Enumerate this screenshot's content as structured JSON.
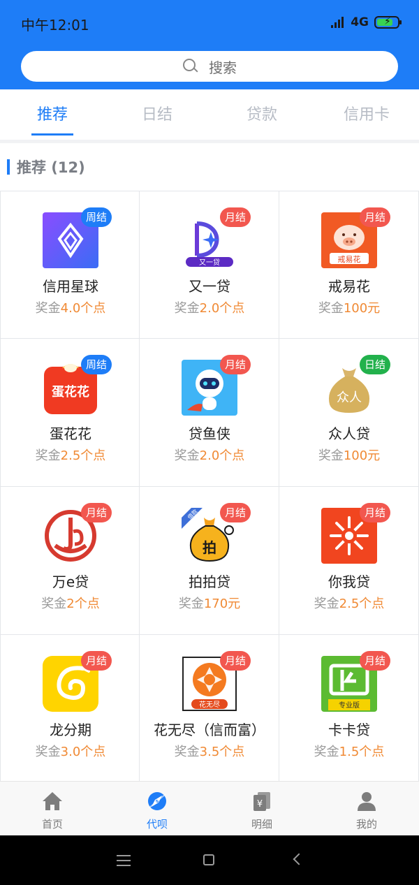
{
  "status": {
    "time": "中午12:01",
    "network": "4G"
  },
  "search": {
    "placeholder": "搜索"
  },
  "tabs": [
    {
      "label": "推荐",
      "active": true
    },
    {
      "label": "日结",
      "active": false
    },
    {
      "label": "贷款",
      "active": false
    },
    {
      "label": "信用卡",
      "active": false
    }
  ],
  "section": {
    "title": "推荐 (12)"
  },
  "reward_label": "奖金",
  "products": [
    {
      "name": "信用星球",
      "badge": "周结",
      "badge_type": "weekly",
      "reward": "4.0个点",
      "icon": "diamond-icon"
    },
    {
      "name": "又一贷",
      "badge": "月结",
      "badge_type": "monthly",
      "reward": "2.0个点",
      "icon": "youyidai-logo-icon",
      "logo_text": "又一贷"
    },
    {
      "name": "戒易花",
      "badge": "月结",
      "badge_type": "monthly",
      "reward": "100元",
      "icon": "pig-icon",
      "logo_text": "戒易花"
    },
    {
      "name": "蛋花花",
      "badge": "周结",
      "badge_type": "weekly",
      "reward": "2.5个点",
      "icon": "danhuahua-logo-icon",
      "logo_text": "蛋花花"
    },
    {
      "name": "贷鱼侠",
      "badge": "月结",
      "badge_type": "monthly",
      "reward": "2.0个点",
      "icon": "robot-icon"
    },
    {
      "name": "众人贷",
      "badge": "日结",
      "badge_type": "daily",
      "reward": "100元",
      "icon": "money-bag-icon",
      "logo_text": "众人"
    },
    {
      "name": "万e贷",
      "badge": "月结",
      "badge_type": "monthly",
      "reward": "2个点",
      "icon": "wanedai-logo-icon"
    },
    {
      "name": "拍拍贷",
      "badge": "月结",
      "badge_type": "monthly",
      "reward": "170元",
      "icon": "paipaidai-bag-icon",
      "logo_text": "拍",
      "ribbon_text": "借款"
    },
    {
      "name": "你我贷",
      "badge": "月结",
      "badge_type": "monthly",
      "reward": "2.5个点",
      "icon": "niwodai-logo-icon"
    },
    {
      "name": "龙分期",
      "badge": "月结",
      "badge_type": "monthly",
      "reward": "3.0个点",
      "icon": "dragon-icon"
    },
    {
      "name": "花无尽（信而富）",
      "badge": "月结",
      "badge_type": "monthly",
      "reward": "3.5个点",
      "icon": "huawujin-logo-icon",
      "logo_text": "花无尽"
    },
    {
      "name": "卡卡贷",
      "badge": "月结",
      "badge_type": "monthly",
      "reward": "1.5个点",
      "icon": "kakadai-logo-icon",
      "logo_text": "专业版"
    }
  ],
  "bottom_nav": [
    {
      "label": "首页",
      "icon": "home-icon",
      "active": false
    },
    {
      "label": "代呗",
      "icon": "compass-icon",
      "active": true
    },
    {
      "label": "明细",
      "icon": "ledger-icon",
      "active": false
    },
    {
      "label": "我的",
      "icon": "user-icon",
      "active": false
    }
  ],
  "colors": {
    "primary": "#1e7df7",
    "reward": "#f08a35",
    "monthly": "#f2574f",
    "daily": "#22b14c"
  }
}
